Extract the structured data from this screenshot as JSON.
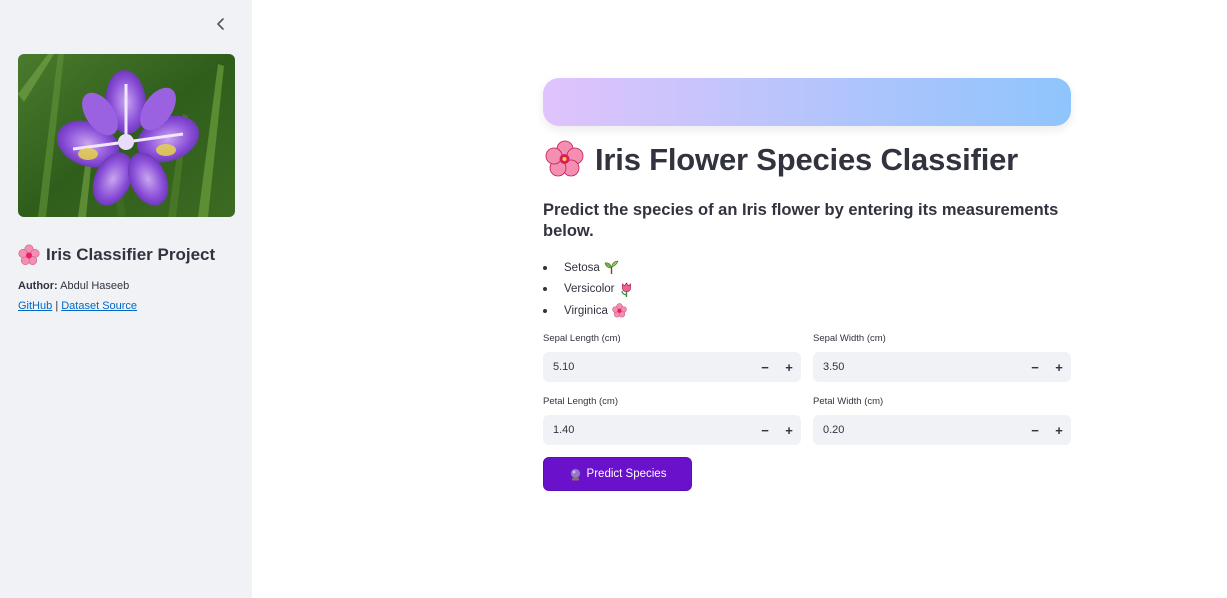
{
  "sidebar": {
    "image_alt": "Iris flower",
    "project_title": "Iris Classifier Project",
    "author_label": "Author:",
    "author_name": "Abdul Haseeb",
    "links": [
      "GitHub",
      "Dataset Source"
    ],
    "link_separator": "|"
  },
  "main": {
    "title": "Iris Flower Species Classifier",
    "subtitle": "Predict the species of an Iris flower by entering its measurements below.",
    "species": [
      {
        "name": "Setosa",
        "icon": "seedling-icon"
      },
      {
        "name": "Versicolor",
        "icon": "tulip-icon"
      },
      {
        "name": "Virginica",
        "icon": "cherry-blossom-icon"
      }
    ],
    "inputs": [
      {
        "label": "Sepal Length (cm)",
        "value": "5.10"
      },
      {
        "label": "Sepal Width (cm)",
        "value": "3.50"
      },
      {
        "label": "Petal Length (cm)",
        "value": "1.40"
      },
      {
        "label": "Petal Width (cm)",
        "value": "0.20"
      }
    ],
    "minus": "−",
    "plus": "+",
    "predict_label": "Predict Species"
  },
  "colors": {
    "sidebar_bg": "#f0f2f6",
    "banner_start": "#e0c3fc",
    "banner_end": "#8ec5fc",
    "button_bg": "#6a11cb",
    "link": "#0068c9"
  }
}
